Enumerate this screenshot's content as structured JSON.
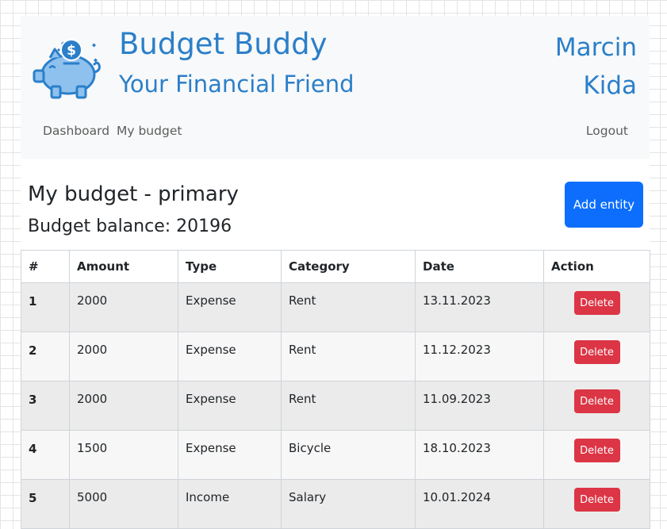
{
  "brand": {
    "title": "Budget Buddy",
    "subtitle": "Your Financial Friend",
    "logo_icon": "piggy-bank-icon"
  },
  "user": {
    "first": "Marcin",
    "last": "Kida"
  },
  "nav": {
    "dashboard": "Dashboard",
    "my_budget": "My budget",
    "logout": "Logout"
  },
  "main": {
    "heading": "My budget - primary",
    "balance": "Budget balance: 20196",
    "add_button": "Add entity"
  },
  "colors": {
    "brand": "#2b7fc9",
    "primary_button": "#0d6efd",
    "danger_button": "#dc3545"
  },
  "table": {
    "headers": [
      "#",
      "Amount",
      "Type",
      "Category",
      "Date",
      "Action"
    ],
    "delete_label": "Delete",
    "rows": [
      {
        "n": "1",
        "amount": "2000",
        "type": "Expense",
        "category": "Rent",
        "date": "13.11.2023"
      },
      {
        "n": "2",
        "amount": "2000",
        "type": "Expense",
        "category": "Rent",
        "date": "11.12.2023"
      },
      {
        "n": "3",
        "amount": "2000",
        "type": "Expense",
        "category": "Rent",
        "date": "11.09.2023"
      },
      {
        "n": "4",
        "amount": "1500",
        "type": "Expense",
        "category": "Bicycle",
        "date": "18.10.2023"
      },
      {
        "n": "5",
        "amount": "5000",
        "type": "Income",
        "category": "Salary",
        "date": "10.01.2024"
      }
    ]
  }
}
